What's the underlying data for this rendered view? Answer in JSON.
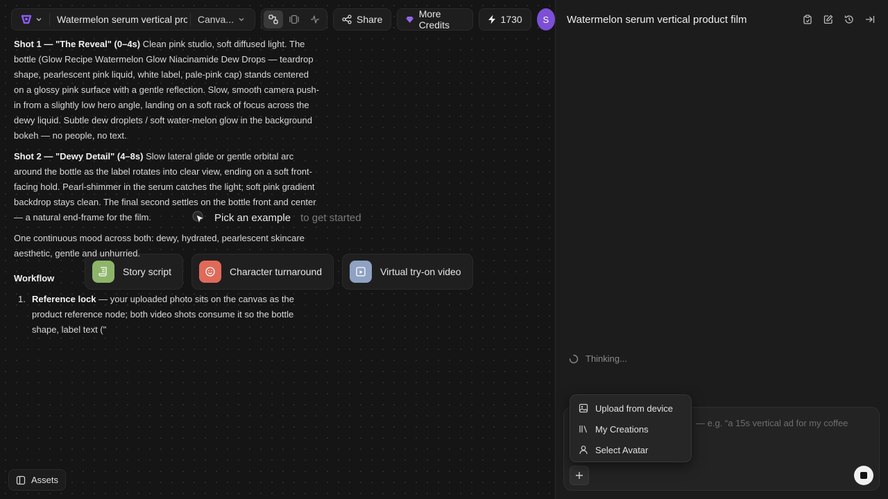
{
  "header": {
    "project_title": "Watermelon serum vertical product film",
    "view_label": "Canva...",
    "share_label": "Share",
    "credits_label": "More Credits",
    "credit_count": "1730",
    "avatar_initial": "S"
  },
  "canvas": {
    "hint_main": "Pick an example",
    "hint_sub": "to get started",
    "examples": [
      {
        "label": "Story script",
        "color": "#8db56a"
      },
      {
        "label": "Character turnaround",
        "color": "#e06a5a"
      },
      {
        "label": "Virtual try-on video",
        "color": "#8fa2c4"
      }
    ],
    "assets_label": "Assets"
  },
  "panel": {
    "title": "Watermelon serum vertical product film",
    "shot1_title": "Shot 1 — \"The Reveal\" (0–4s)",
    "shot1_text": "Clean pink studio, soft diffused light. The bottle (Glow Recipe Watermelon Glow Niacinamide Dew Drops — teardrop shape, pearlescent pink liquid, white label, pale-pink cap) stands centered on a glossy pink surface with a gentle reflection. Slow, smooth camera push-in from a slightly low hero angle, landing on a soft rack of focus across the dewy liquid. Subtle dew droplets / soft water-melon glow in the background bokeh — no people, no text.",
    "shot2_title": "Shot 2 — \"Dewy Detail\" (4–8s)",
    "shot2_text": "Slow lateral glide or gentle orbital arc around the bottle as the label rotates into clear view, ending on a soft front-facing hold. Pearl-shimmer in the serum catches the light; soft pink gradient backdrop stays clean. The final second settles on the bottle front and center — a natural end-frame for the film.",
    "mood_text": "One continuous mood across both: dewy, hydrated, pearlescent skincare aesthetic, gentle and unhurried.",
    "workflow_title": "Workflow",
    "workflow_num": "1.",
    "workflow_item_title": "Reference lock",
    "workflow_item_text": "— your uploaded photo sits on the canvas as the product reference node; both video shots consume it so the bottle shape, label text (\"",
    "thinking": "Thinking...",
    "composer_placeholder": "— e.g. “a 15s vertical ad for my coffee",
    "menu": {
      "upload": "Upload from device",
      "creations": "My Creations",
      "avatar": "Select Avatar"
    }
  }
}
